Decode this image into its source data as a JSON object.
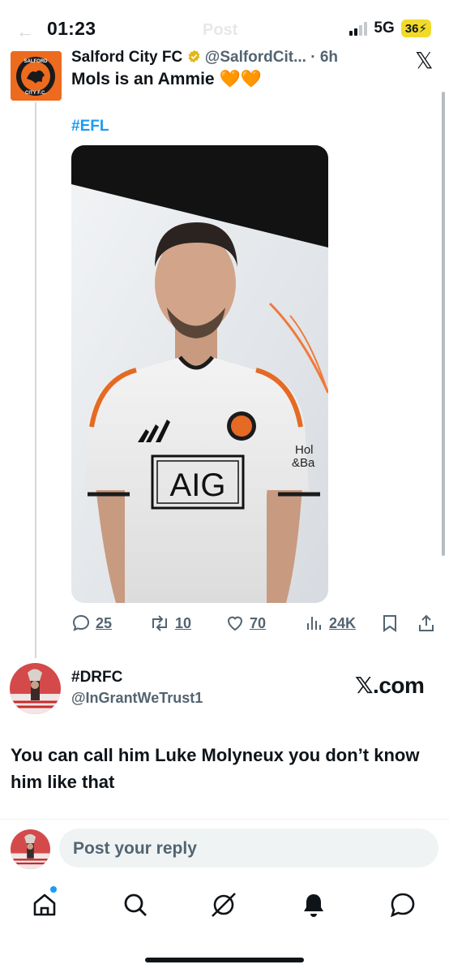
{
  "status_bar": {
    "time": "01:23",
    "network": "5G",
    "battery": "36"
  },
  "ghost_header": {
    "back": "←",
    "title": "Post"
  },
  "tweet": {
    "author_name": "Salford City FC",
    "handle_time": "@SalfordCit... · 6h",
    "text": "Mols is an Ammie 🧡🧡",
    "hashtag": "#EFL",
    "close_icon": "x-logo",
    "media": {
      "sponsor": "AIG",
      "sleeve_text_1": "Hol",
      "sleeve_text_2": "&Ba",
      "badge_text": "SALFORD CITY FC"
    },
    "stats": {
      "replies": "25",
      "reposts": "10",
      "likes": "70",
      "views": "24K"
    }
  },
  "reply": {
    "name": "#DRFC",
    "handle": "@InGrantWeTrust1",
    "watermark": "𝕏.com",
    "text": "You can call him Luke Molyneux you don’t know him like that"
  },
  "compose": {
    "placeholder": "Post your reply"
  },
  "nav": [
    "home-icon",
    "search-icon",
    "grok-icon",
    "notifications-icon",
    "messages-icon"
  ],
  "colors": {
    "brand_orange": "#ed6b1f",
    "link_blue": "#1d9bf0",
    "muted": "#536471"
  }
}
